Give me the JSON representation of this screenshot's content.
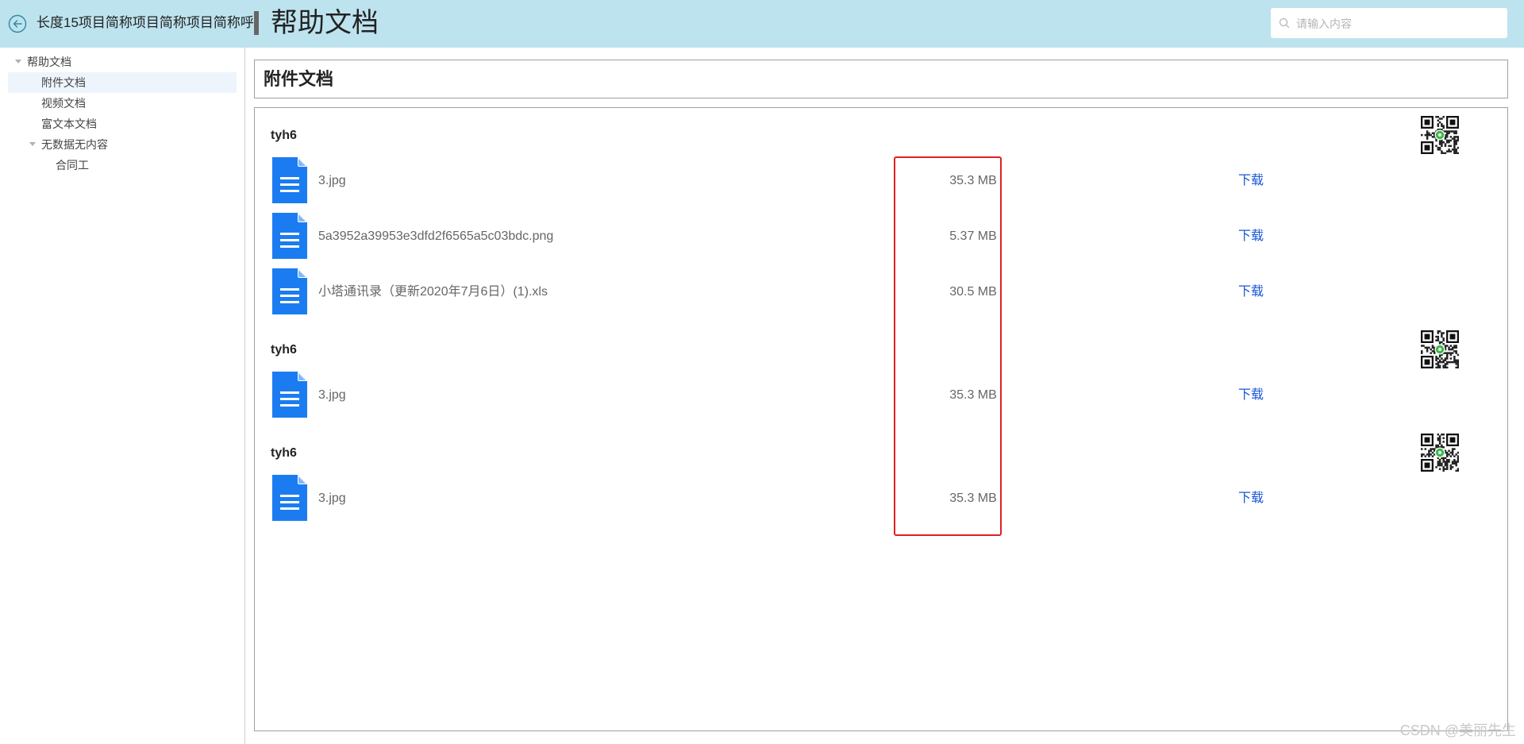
{
  "header": {
    "project_name": "长度15项目简称项目简称项目简称呼",
    "page_title": "帮助文档",
    "search_placeholder": "请输入内容",
    "bg_color": "#bde3ef"
  },
  "sidebar": {
    "root": {
      "label": "帮助文档",
      "expanded": true
    },
    "items": [
      {
        "label": "附件文档",
        "selected": true
      },
      {
        "label": "视频文档",
        "selected": false
      },
      {
        "label": "富文本文档",
        "selected": false
      }
    ],
    "subgroup": {
      "label": "无数据无内容",
      "expanded": true,
      "children": [
        {
          "label": "合同工"
        }
      ]
    }
  },
  "main": {
    "section_title": "附件文档",
    "download_label": "下载",
    "groups": [
      {
        "title": "tyh6",
        "files": [
          {
            "name": "3.jpg",
            "size": "35.3 MB"
          },
          {
            "name": "5a3952a39953e3dfd2f6565a5c03bdc.png",
            "size": "5.37 MB"
          },
          {
            "name": "小塔通讯录（更新2020年7月6日）(1).xls",
            "size": "30.5 MB"
          }
        ]
      },
      {
        "title": "tyh6",
        "files": [
          {
            "name": "3.jpg",
            "size": "35.3 MB"
          }
        ]
      },
      {
        "title": "tyh6",
        "files": [
          {
            "name": "3.jpg",
            "size": "35.3 MB"
          }
        ]
      }
    ]
  },
  "watermark": "CSDN @美丽先生",
  "colors": {
    "file_icon": "#1b7cf2",
    "download_link": "#1a56d6",
    "highlight": "#e02020"
  },
  "icons": {
    "back": "back-arrow-icon",
    "search": "search-icon",
    "file": "document-icon",
    "qr": "qr-code-icon"
  }
}
